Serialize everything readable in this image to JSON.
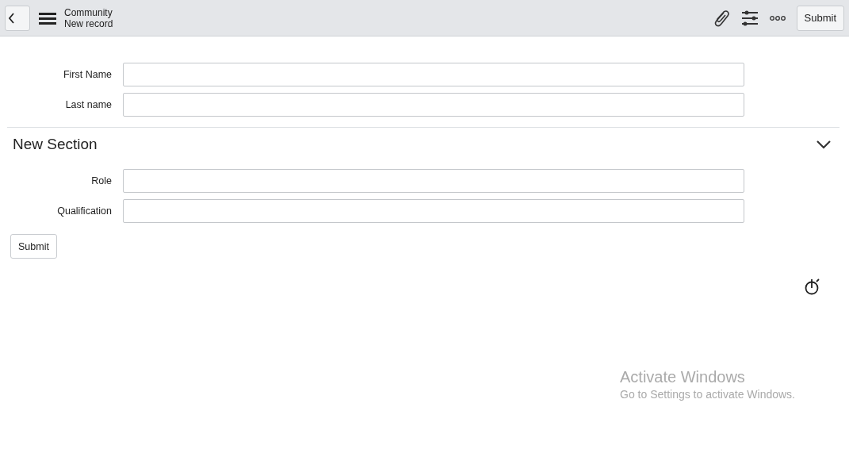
{
  "header": {
    "title": "Community",
    "subtitle": "New record",
    "submit": "Submit"
  },
  "fields": [
    {
      "label": "First Name"
    },
    {
      "label": "Last name"
    }
  ],
  "section": {
    "title": "New Section",
    "expanded": true,
    "fields": [
      {
        "label": "Role"
      },
      {
        "label": "Qualification"
      }
    ]
  },
  "submit": "Submit",
  "os_notice": {
    "title": "Activate Windows",
    "text": "Go to Settings to activate Windows."
  }
}
